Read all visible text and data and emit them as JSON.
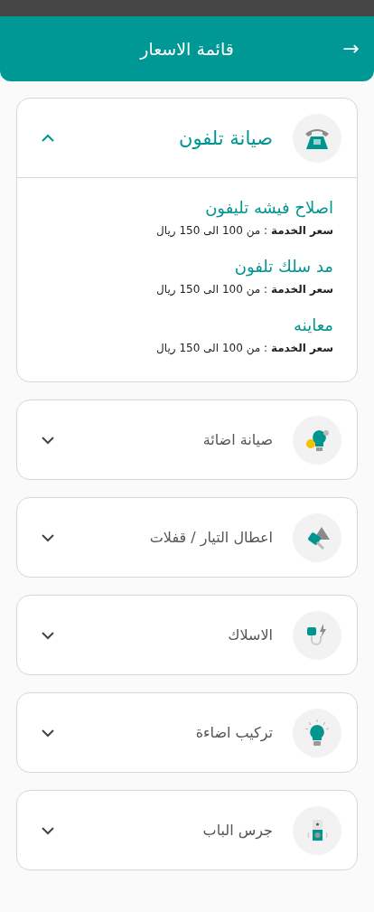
{
  "header": {
    "title": "قائمة الاسعار",
    "back": "→"
  },
  "sections": [
    {
      "title": "صيانة تلفون",
      "expanded": true,
      "services": [
        {
          "name": "اصلاح فيشه تليفون",
          "price": "**سعر الخدمة** : من 100 الى 150 ريال"
        },
        {
          "name": "مد سلك تلفون",
          "price": "**سعر الخدمة** : من 100 الى 150 ريال"
        },
        {
          "name": "معاينه",
          "price": "**سعر الخدمة** : من 100 الى 150 ريال"
        }
      ]
    },
    {
      "title": "صيانة اضائة",
      "expanded": false
    },
    {
      "title": "اعطال التيار / قفلات",
      "expanded": false
    },
    {
      "title": "الاسلاك",
      "expanded": false
    },
    {
      "title": "تركيب اضاءة",
      "expanded": false
    },
    {
      "title": "جرس الباب",
      "expanded": false
    }
  ]
}
